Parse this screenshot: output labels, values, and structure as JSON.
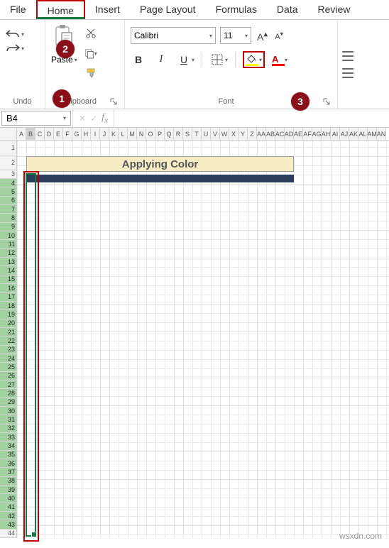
{
  "tabs": [
    "File",
    "Home",
    "Insert",
    "Page Layout",
    "Formulas",
    "Data",
    "Review"
  ],
  "active_tab": "Home",
  "undo_group": {
    "label": "Undo"
  },
  "clipboard": {
    "paste": "Paste",
    "label": "Clipboard"
  },
  "font": {
    "family": "Calibri",
    "size": "11",
    "label": "Font"
  },
  "namebox": "B4",
  "columns": [
    "A",
    "B",
    "C",
    "D",
    "E",
    "F",
    "G",
    "H",
    "I",
    "J",
    "K",
    "L",
    "M",
    "N",
    "O",
    "P",
    "Q",
    "R",
    "S",
    "T",
    "U",
    "V",
    "W",
    "X",
    "Y",
    "Z",
    "AA",
    "AB",
    "AC",
    "AD",
    "AE",
    "AF",
    "AG",
    "AH",
    "AI",
    "AJ",
    "AK",
    "AL",
    "AM",
    "AN"
  ],
  "rows_tall": [
    1,
    2
  ],
  "rows_short_start": 3,
  "rows_short_end": 44,
  "title_cell": "Applying Color",
  "badges": {
    "b1": "1",
    "b2": "2",
    "b3": "3"
  },
  "watermark": "wsxdn.com"
}
